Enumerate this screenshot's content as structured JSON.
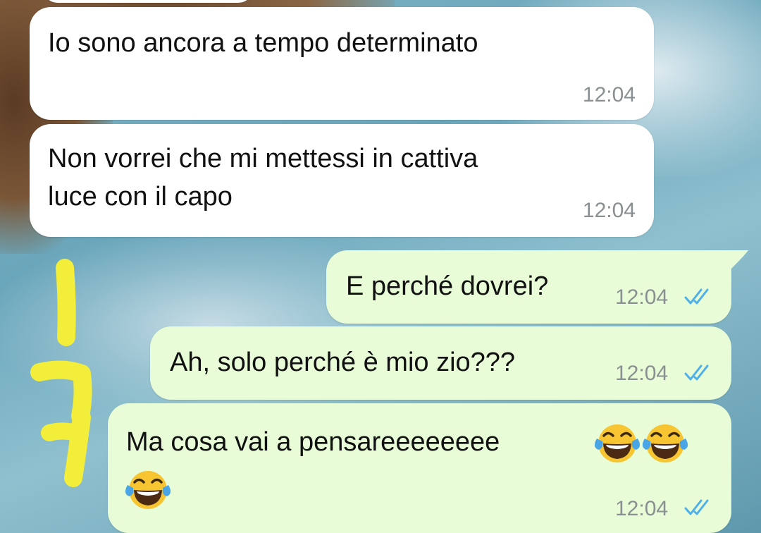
{
  "messages": [
    {
      "direction": "incoming",
      "text": "Io sono ancora a tempo determinato",
      "time": "12:04"
    },
    {
      "direction": "incoming",
      "text": "Non vorrei che mi mettessi in cattiva\nluce con il capo",
      "time": "12:04"
    },
    {
      "direction": "outgoing",
      "text": "E perché dovrei?",
      "time": "12:04",
      "status": "read"
    },
    {
      "direction": "outgoing",
      "text": "Ah, solo perché è mio zio???",
      "time": "12:04",
      "status": "read"
    },
    {
      "direction": "outgoing",
      "text": "Ma cosa vai a pensareeeeeeee",
      "emojis_inline": [
        "face-with-tears-of-joy",
        "face-with-tears-of-joy"
      ],
      "emojis_next_line": [
        "face-with-tears-of-joy"
      ],
      "time": "12:04",
      "status": "read"
    }
  ],
  "annotation": {
    "label": "handwritten yellow marker number 17",
    "color": "#f2ee3a"
  },
  "colors": {
    "incoming": "#ffffff",
    "outgoing": "#e7fcd7",
    "read_ticks": "#4fb0e8",
    "timestamp": "#8a8f92"
  }
}
